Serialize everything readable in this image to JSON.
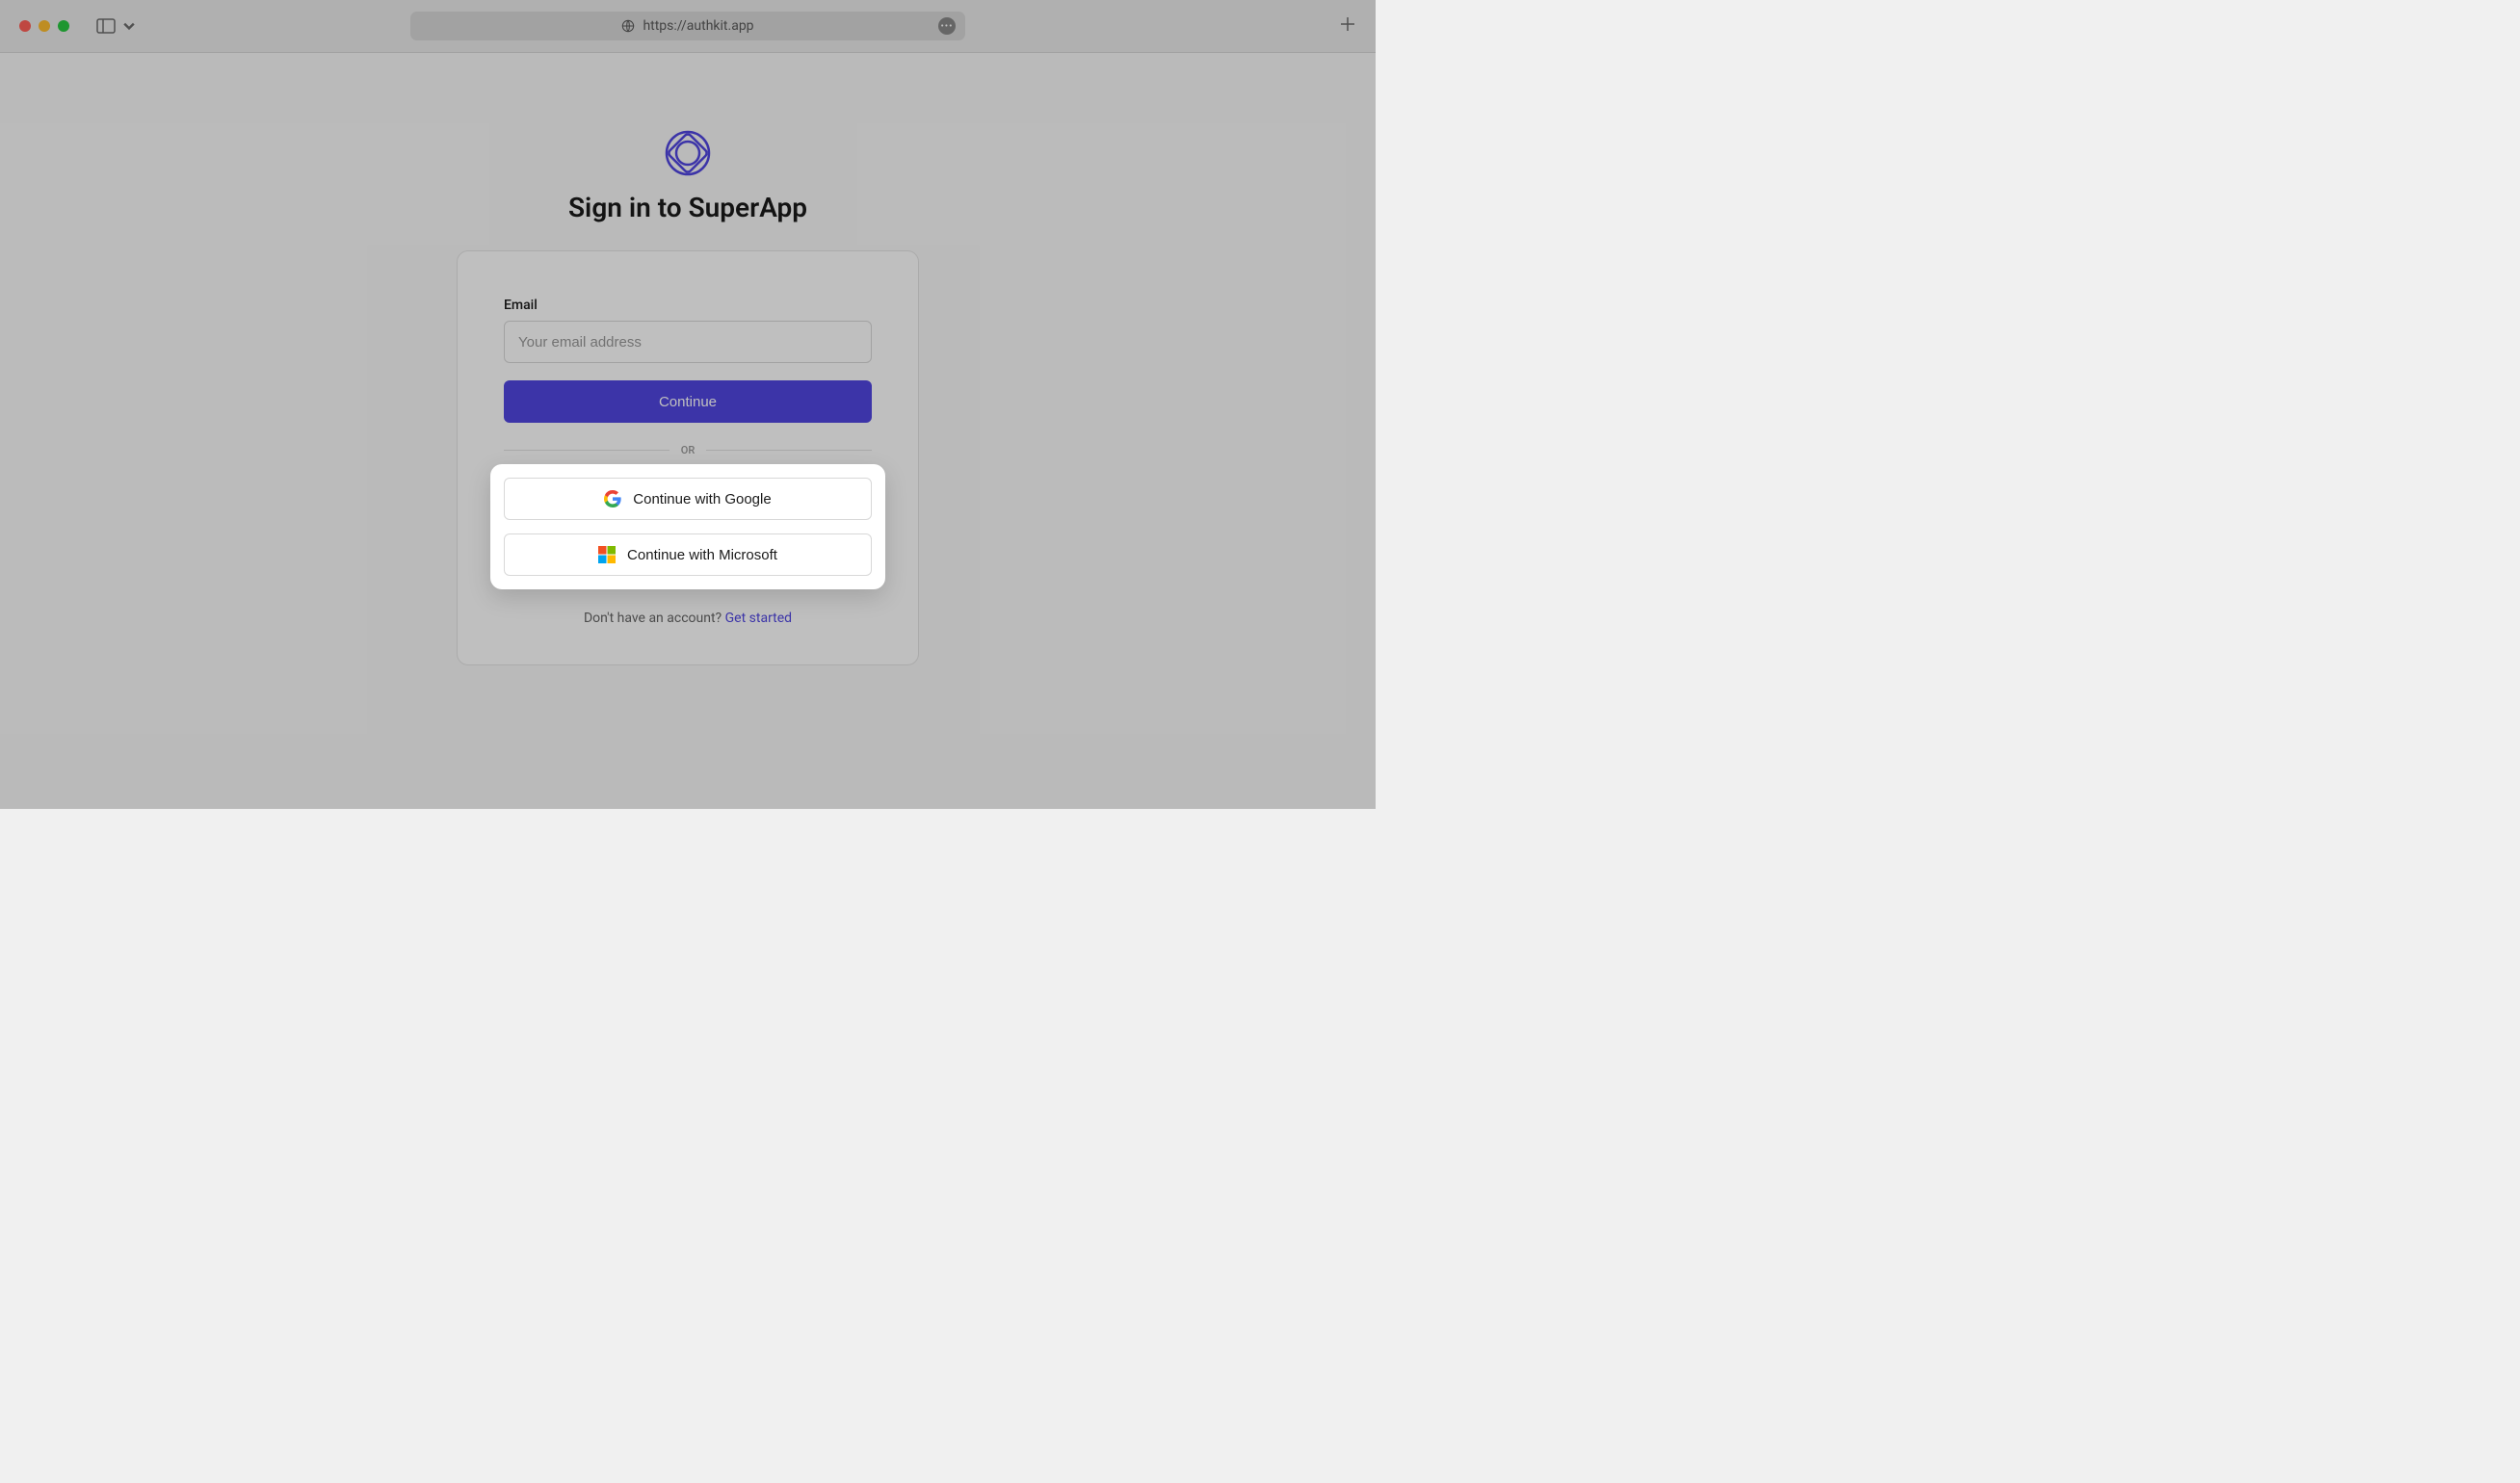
{
  "browser": {
    "url": "https://authkit.app"
  },
  "auth": {
    "heading": "Sign in to SuperApp",
    "email_label": "Email",
    "email_placeholder": "Your email address",
    "email_value": "",
    "continue_label": "Continue",
    "divider_text": "OR",
    "google_label": "Continue with Google",
    "microsoft_label": "Continue with Microsoft",
    "no_account_text": "Don't have an account? ",
    "signup_link_text": "Get started"
  },
  "colors": {
    "accent": "#5046e1"
  }
}
